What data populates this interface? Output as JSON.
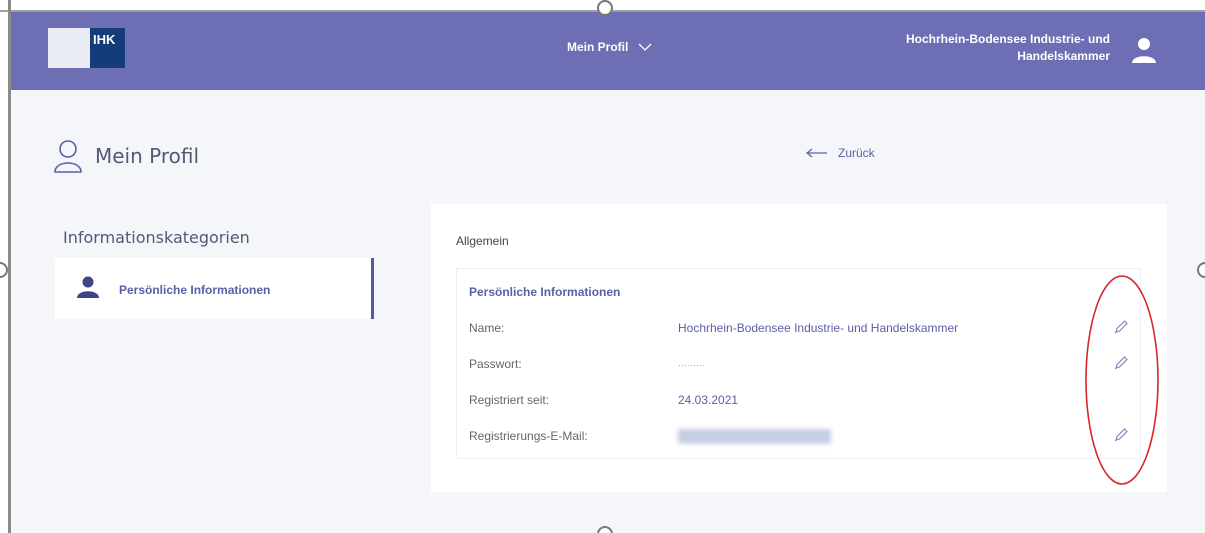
{
  "header": {
    "logo_text": "IHK",
    "profile_menu_label": "Mein Profil",
    "organization_name": "Hochrhein-Bodensee Industrie- und Handelskammer"
  },
  "page": {
    "title": "Mein Profil",
    "back_label": "Zurück"
  },
  "sidebar": {
    "heading": "Informationskategorien",
    "items": [
      {
        "label": "Persönliche Informationen",
        "active": true
      }
    ]
  },
  "main": {
    "section_title": "Allgemein",
    "info_box": {
      "title": "Persönliche Informationen",
      "rows": [
        {
          "label": "Name:",
          "value": "Hochrhein-Bodensee Industrie- und Handelskammer",
          "editable": true
        },
        {
          "label": "Passwort:",
          "value": "·········",
          "editable": true
        },
        {
          "label": "Registriert seit:",
          "value": "24.03.2021",
          "editable": false
        },
        {
          "label": "Registrierungs-E-Mail:",
          "value": "",
          "editable": true
        }
      ]
    }
  },
  "colors": {
    "header_bg": "#6d6eb4",
    "accent": "#5b5fa6",
    "page_bg": "#f4f6fa",
    "annotation": "#d62828"
  },
  "icons": {
    "chevron": "chevron-down-icon",
    "user": "user-icon",
    "back": "arrow-left-icon",
    "edit": "pencil-icon"
  }
}
